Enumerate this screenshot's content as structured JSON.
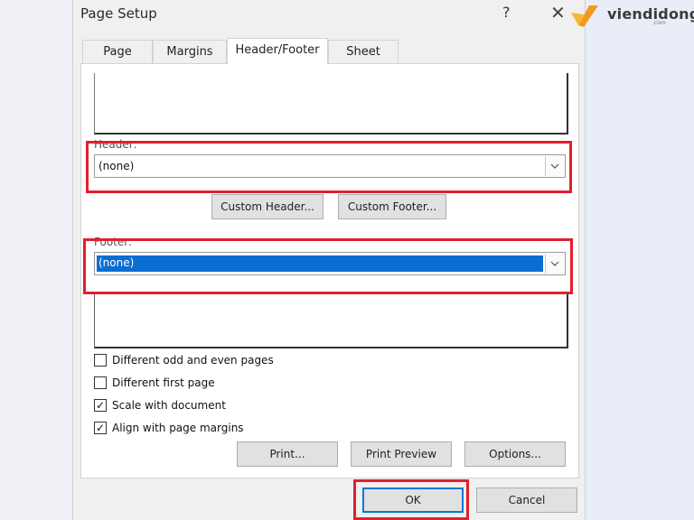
{
  "dialog": {
    "title": "Page Setup",
    "help_label": "?",
    "close_label": "✕"
  },
  "brand": {
    "name": "viendidong",
    "sub": ".com"
  },
  "tabs": [
    {
      "label": "Page"
    },
    {
      "label": "Margins"
    },
    {
      "label": "Header/Footer"
    },
    {
      "label": "Sheet"
    }
  ],
  "header": {
    "label": "Header:",
    "value": "(none)"
  },
  "footer": {
    "label": "Footer:",
    "value": "(none)"
  },
  "buttons": {
    "custom_header": "Custom Header...",
    "custom_footer": "Custom Footer...",
    "print": "Print...",
    "print_preview": "Print Preview",
    "options": "Options...",
    "ok": "OK",
    "cancel": "Cancel"
  },
  "options": [
    {
      "label": "Different odd and even pages",
      "checked": false
    },
    {
      "label": "Different first page",
      "checked": false
    },
    {
      "label": "Scale with document",
      "checked": true
    },
    {
      "label": "Align with page margins",
      "checked": true
    }
  ],
  "icons": {
    "dropdown": "chevron-down-icon",
    "brand_mark": "brand-logo-icon"
  },
  "colors": {
    "highlight": "#e0202e",
    "selection": "#0a6ed1",
    "brand_orange": "#f29a1c"
  }
}
